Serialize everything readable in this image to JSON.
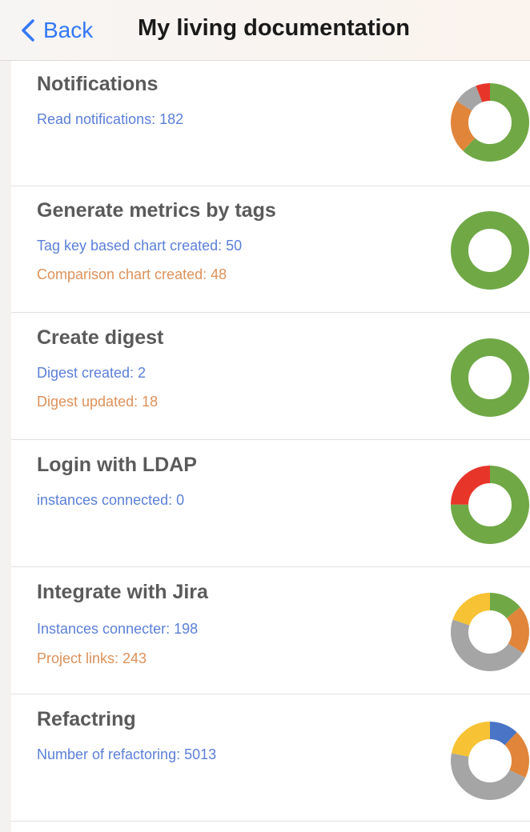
{
  "nav": {
    "back_label": "Back",
    "title": "My living documentation"
  },
  "colors": {
    "ios_blue": "#3478f6",
    "metric_blue": "#5b7fd8",
    "metric_orange": "#dd915a",
    "chart_green": "#70a846",
    "chart_orange": "#e0853a",
    "chart_gray": "#a5a5a5",
    "chart_red": "#e8352a",
    "chart_yellow": "#f7c233",
    "chart_blue": "#4a74c6"
  },
  "features": [
    {
      "title": "Notifications",
      "metrics": [
        {
          "text": "Read notifications: 182",
          "tone": "blue"
        }
      ],
      "donut": [
        {
          "name": "green",
          "fraction": 0.62
        },
        {
          "name": "orange",
          "fraction": 0.22
        },
        {
          "name": "gray",
          "fraction": 0.1
        },
        {
          "name": "red",
          "fraction": 0.06
        }
      ]
    },
    {
      "title": "Generate metrics by tags",
      "metrics": [
        {
          "text": "Tag key based chart created: 50",
          "tone": "blue"
        },
        {
          "text": "Comparison chart created: 48",
          "tone": "orange"
        }
      ],
      "donut": [
        {
          "name": "green",
          "fraction": 1.0
        }
      ]
    },
    {
      "title": "Create digest",
      "metrics": [
        {
          "text": "Digest created: 2",
          "tone": "blue"
        },
        {
          "text": "Digest updated: 18",
          "tone": "orange"
        }
      ],
      "donut": [
        {
          "name": "green",
          "fraction": 1.0
        }
      ]
    },
    {
      "title": "Login with LDAP",
      "metrics": [
        {
          "text": "instances connected: 0",
          "tone": "blue"
        }
      ],
      "donut": [
        {
          "name": "green",
          "fraction": 0.75
        },
        {
          "name": "red",
          "fraction": 0.25
        }
      ]
    },
    {
      "title": "Integrate with Jira",
      "metrics": [
        {
          "text": "Instances connecter: 198",
          "tone": "blue"
        },
        {
          "text": "Project links: 243",
          "tone": "orange"
        }
      ],
      "donut": [
        {
          "name": "green",
          "fraction": 0.14
        },
        {
          "name": "orange",
          "fraction": 0.2
        },
        {
          "name": "gray",
          "fraction": 0.46
        },
        {
          "name": "yellow",
          "fraction": 0.2
        }
      ]
    },
    {
      "title": "Refactring",
      "metrics": [
        {
          "text": "Number of refactoring: 5013",
          "tone": "blue"
        }
      ],
      "donut": [
        {
          "name": "blue",
          "fraction": 0.12
        },
        {
          "name": "orange",
          "fraction": 0.2
        },
        {
          "name": "gray",
          "fraction": 0.46
        },
        {
          "name": "yellow",
          "fraction": 0.22
        }
      ]
    }
  ]
}
